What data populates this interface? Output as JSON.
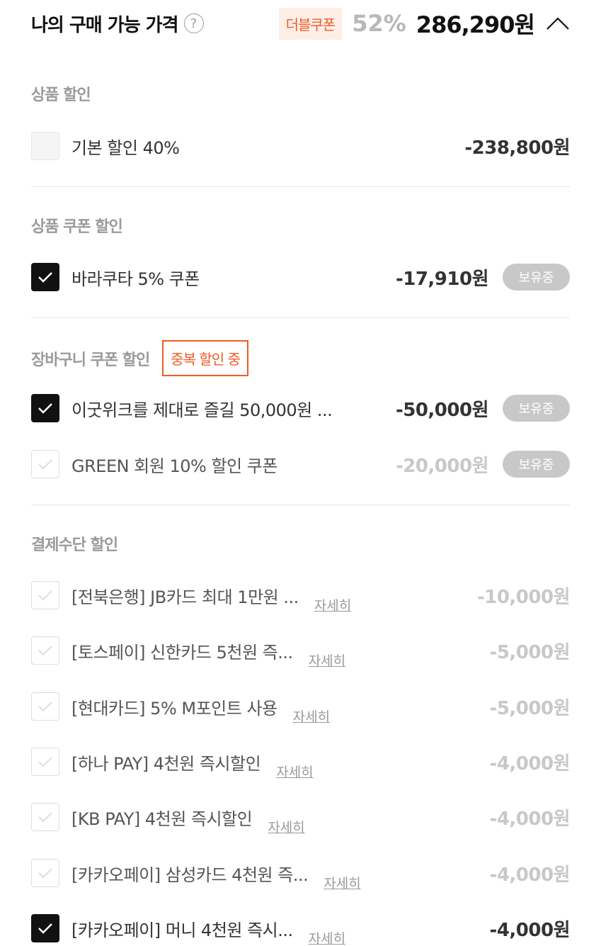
{
  "header": {
    "title": "나의 구매 가능 가격",
    "help_icon": "question-circle-icon",
    "help_glyph": "?",
    "double_coupon_label": "더블쿠폰",
    "discount_rate": "52%",
    "final_price": "286,290원",
    "collapse_icon": "chevron-up-icon"
  },
  "colors": {
    "accent": "#f15a24",
    "accent_bg": "#fdeee8",
    "checked": "#111111",
    "muted": "#c8c8c8",
    "section_title": "#9a9a9a"
  },
  "sections": {
    "product_discount": {
      "title": "상품 할인",
      "items": [
        {
          "label": "기본 할인 40%",
          "amount": "-238,800원"
        }
      ]
    },
    "product_coupon": {
      "title": "상품 쿠폰 할인",
      "items": [
        {
          "label": "바라쿠타 5% 쿠폰",
          "amount": "-17,910원",
          "badge": "보유중",
          "checked": true
        }
      ]
    },
    "cart_coupon": {
      "title": "장바구니 쿠폰 할인",
      "dup_badge": "중복 할인 중",
      "items": [
        {
          "label": "이굿위크를 제대로 즐길 50,000원 ...",
          "amount": "-50,000원",
          "badge": "보유중",
          "checked": true
        },
        {
          "label": "GREEN 회원 10% 할인 쿠폰",
          "amount": "-20,000원",
          "badge": "보유중",
          "checked": false
        }
      ]
    },
    "payment": {
      "title": "결제수단 할인",
      "items": [
        {
          "label": "[전북은행] JB카드 최대 1만원 ...",
          "link": "자세히",
          "amount": "-10,000원",
          "checked": false
        },
        {
          "label": "[토스페이] 신한카드 5천원 즉...",
          "link": "자세히",
          "amount": "-5,000원",
          "checked": false
        },
        {
          "label": "[현대카드] 5% M포인트 사용",
          "link": "자세히",
          "amount": "-5,000원",
          "checked": false
        },
        {
          "label": "[하나 PAY] 4천원 즉시할인",
          "link": "자세히",
          "amount": "-4,000원",
          "checked": false
        },
        {
          "label": "[KB PAY] 4천원 즉시할인",
          "link": "자세히",
          "amount": "-4,000원",
          "checked": false
        },
        {
          "label": "[카카오페이] 삼성카드 4천원 즉...",
          "link": "자세히",
          "amount": "-4,000원",
          "checked": false
        },
        {
          "label": "[카카오페이] 머니 4천원 즉시...",
          "link": "자세히",
          "amount": "-4,000원",
          "checked": true
        }
      ]
    }
  }
}
